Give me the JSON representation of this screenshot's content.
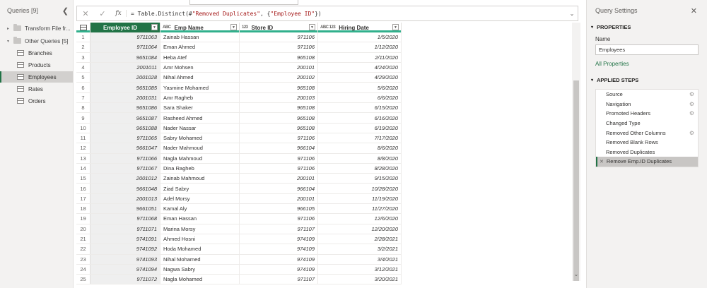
{
  "queries_pane": {
    "title": "Queries [9]",
    "collapse_icon": "chevron-left",
    "groups": [
      {
        "label": "Transform File fr...",
        "expanded": false
      },
      {
        "label": "Other Queries [5]",
        "expanded": true
      }
    ],
    "items": [
      "Branches",
      "Products",
      "Employees",
      "Rates",
      "Orders"
    ],
    "selected": "Employees"
  },
  "formula": {
    "prefix": "= Table.Distinct(#",
    "string1": "\"Removed Duplicates\"",
    "middle": ", {",
    "string2": "\"Employee ID\"",
    "suffix": "})",
    "fx_label": "fx"
  },
  "grid": {
    "columns": [
      {
        "name": "Employee ID",
        "type_icon": "",
        "selected": true
      },
      {
        "name": "Emp Name",
        "type_icon": "ABC",
        "selected": false
      },
      {
        "name": "Store ID",
        "type_icon": "123",
        "selected": false
      },
      {
        "name": "Hiring Date",
        "type_icon": "ABC 123",
        "selected": false
      }
    ],
    "rows": [
      [
        "1",
        "9711063",
        "Zainab Hassan",
        "971106",
        "1/5/2020"
      ],
      [
        "2",
        "9711064",
        "Eman Ahmed",
        "971106",
        "1/12/2020"
      ],
      [
        "3",
        "9651084",
        "Heba Atef",
        "965108",
        "2/11/2020"
      ],
      [
        "4",
        "2001011",
        "Amr Mohsen",
        "200101",
        "4/24/2020"
      ],
      [
        "5",
        "2001028",
        "Nihal Ahmed",
        "200102",
        "4/29/2020"
      ],
      [
        "6",
        "9651085",
        "Yasmine Mohamed",
        "965108",
        "5/6/2020"
      ],
      [
        "7",
        "2001031",
        "Amr Ragheb",
        "200103",
        "6/6/2020"
      ],
      [
        "8",
        "9651086",
        "Sara Shaker",
        "965108",
        "6/15/2020"
      ],
      [
        "9",
        "9651087",
        "Rasheed Ahmed",
        "965108",
        "6/16/2020"
      ],
      [
        "10",
        "9651088",
        "Nader Nassar",
        "965108",
        "6/19/2020"
      ],
      [
        "11",
        "9711065",
        "Sabry Mohamed",
        "971106",
        "7/17/2020"
      ],
      [
        "12",
        "9661047",
        "Nader Mahmoud",
        "966104",
        "8/6/2020"
      ],
      [
        "13",
        "9711066",
        "Nagla Mahmoud",
        "971106",
        "8/8/2020"
      ],
      [
        "14",
        "9711067",
        "Dina Ragheb",
        "971106",
        "8/28/2020"
      ],
      [
        "15",
        "2001012",
        "Zainab Mahmoud",
        "200101",
        "9/15/2020"
      ],
      [
        "16",
        "9661048",
        "Ziad Sabry",
        "966104",
        "10/28/2020"
      ],
      [
        "17",
        "2001013",
        "Adel Morsy",
        "200101",
        "11/19/2020"
      ],
      [
        "18",
        "9661051",
        "Kamal Aly",
        "966105",
        "11/27/2020"
      ],
      [
        "19",
        "9711068",
        "Eman Hassan",
        "971106",
        "12/6/2020"
      ],
      [
        "20",
        "9711071",
        "Marina Morsy",
        "971107",
        "12/20/2020"
      ],
      [
        "21",
        "9741091",
        "Ahmed Hosni",
        "974109",
        "2/28/2021"
      ],
      [
        "22",
        "9741092",
        "Hoda Mohamed",
        "974109",
        "3/2/2021"
      ],
      [
        "23",
        "9741093",
        "Nihal Mohamed",
        "974109",
        "3/4/2021"
      ],
      [
        "24",
        "9741094",
        "Nagwa Sabry",
        "974109",
        "3/12/2021"
      ],
      [
        "25",
        "9711072",
        "Nagla Mohamed",
        "971107",
        "3/20/2021"
      ]
    ]
  },
  "settings": {
    "title": "Query Settings",
    "properties_heading": "PROPERTIES",
    "name_label": "Name",
    "name_value": "Employees",
    "all_properties_link": "All Properties",
    "steps_heading": "APPLIED STEPS",
    "steps": [
      {
        "label": "Source",
        "has_gear": true
      },
      {
        "label": "Navigation",
        "has_gear": true
      },
      {
        "label": "Promoted Headers",
        "has_gear": true
      },
      {
        "label": "Changed Type",
        "has_gear": false
      },
      {
        "label": "Removed Other Columns",
        "has_gear": true
      },
      {
        "label": "Removed Blank Rows",
        "has_gear": false
      },
      {
        "label": "Removed Duplicates",
        "has_gear": false
      },
      {
        "label": "Remove Emp.ID Duplicates",
        "has_gear": false
      }
    ],
    "selected_step": "Remove Emp.ID Duplicates"
  },
  "colors": {
    "accent_green": "#217346",
    "header_underline": "#31b08c"
  }
}
